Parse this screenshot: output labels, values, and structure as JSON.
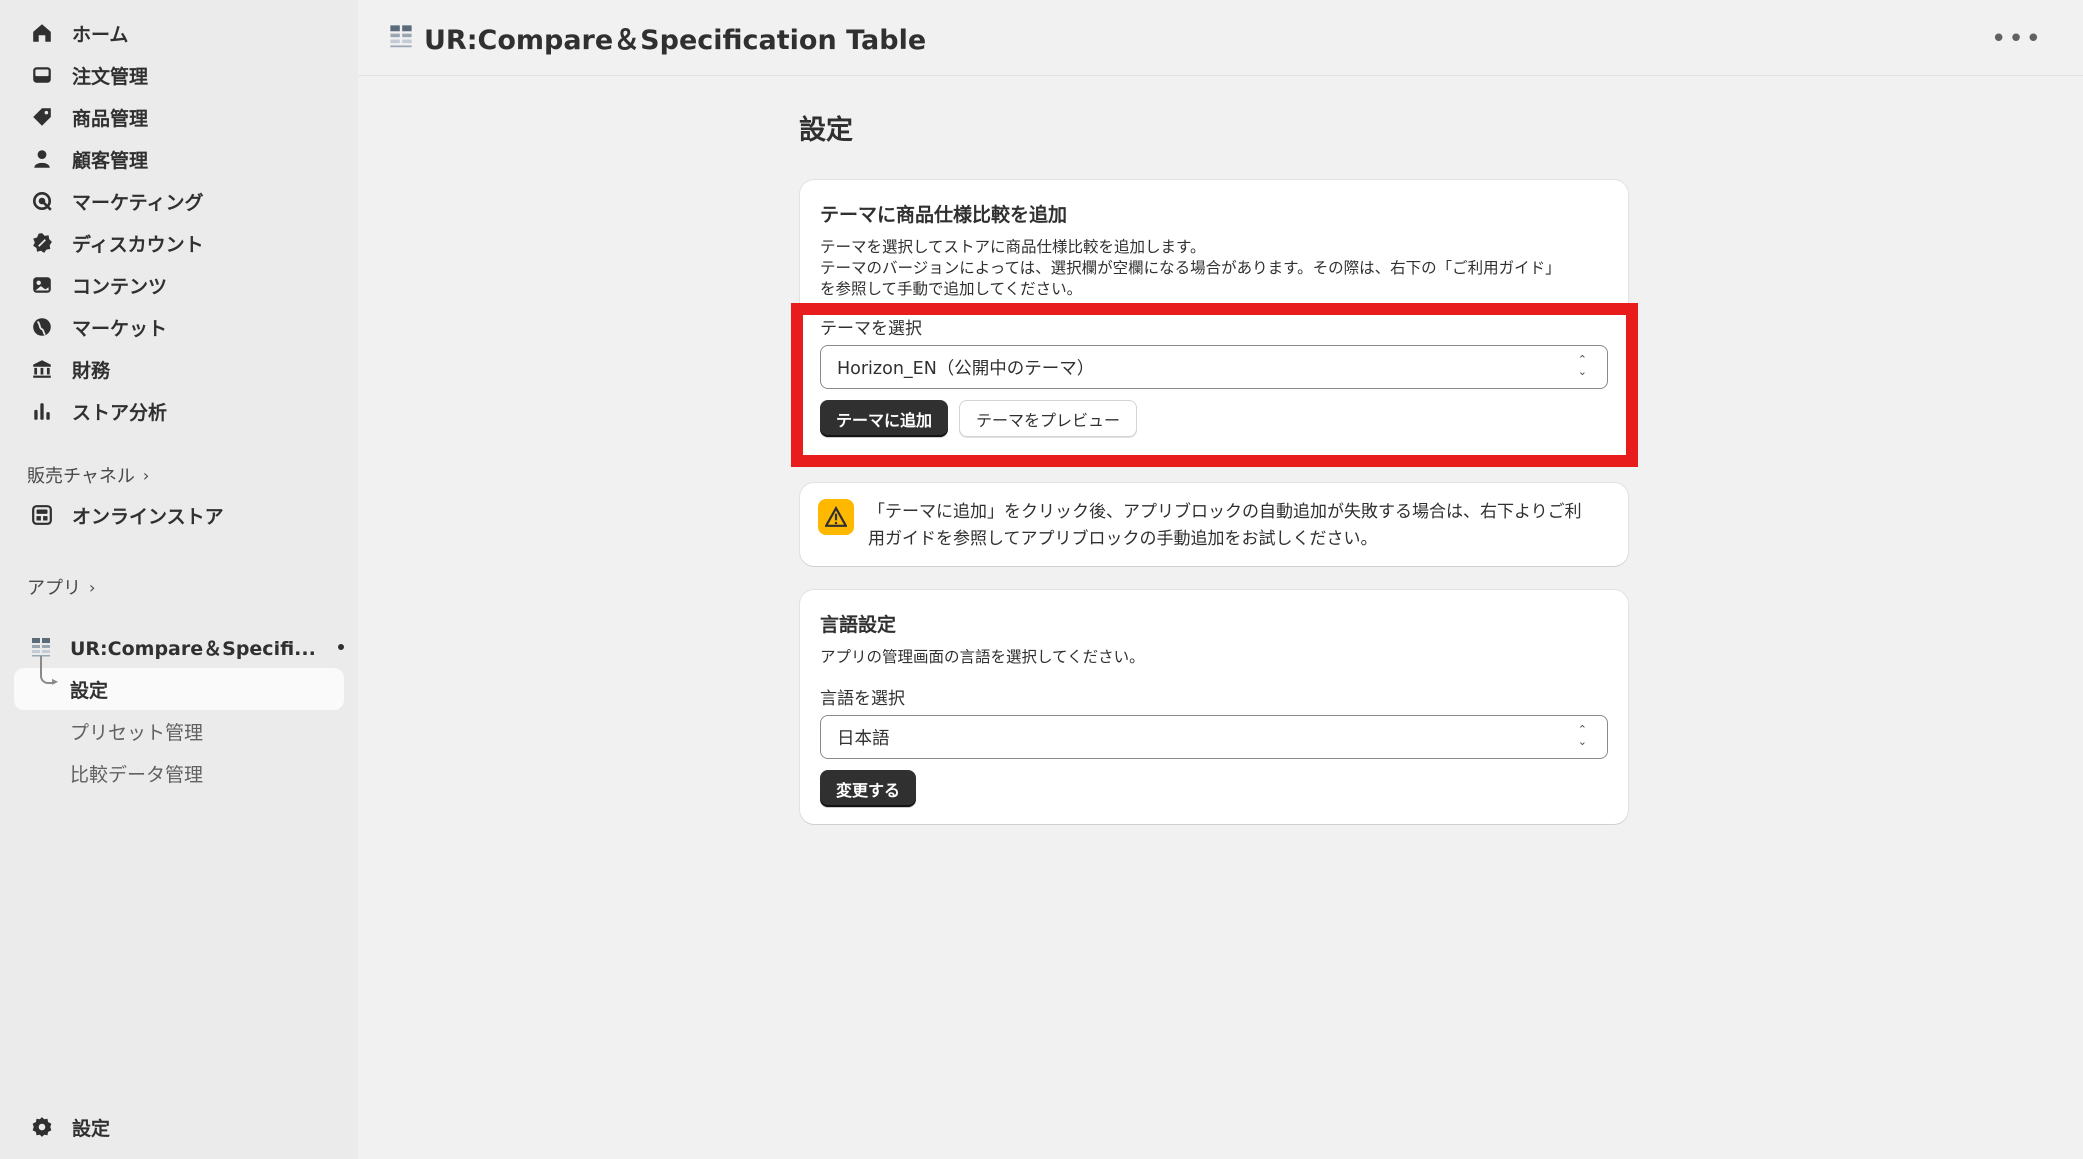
{
  "sidebar": {
    "items": [
      {
        "label": "ホーム",
        "icon": "home-icon"
      },
      {
        "label": "注文管理",
        "icon": "inbox-icon"
      },
      {
        "label": "商品管理",
        "icon": "tag-icon"
      },
      {
        "label": "顧客管理",
        "icon": "person-icon"
      },
      {
        "label": "マーケティング",
        "icon": "target-icon"
      },
      {
        "label": "ディスカウント",
        "icon": "discount-icon"
      },
      {
        "label": "コンテンツ",
        "icon": "image-icon"
      },
      {
        "label": "マーケット",
        "icon": "globe-icon"
      },
      {
        "label": "財務",
        "icon": "bank-icon"
      },
      {
        "label": "ストア分析",
        "icon": "bar-chart-icon"
      }
    ],
    "sales_channels_label": "販売チャネル",
    "online_store_label": "オンラインストア",
    "apps_label": "アプリ",
    "app_name": "UR:Compare＆Specifi...",
    "app_subitems": [
      "設定",
      "プリセット管理",
      "比較データ管理"
    ],
    "settings_label": "設定"
  },
  "header": {
    "title": "UR:Compare＆Specification Table",
    "more_label": "•••"
  },
  "main": {
    "page_title": "設定",
    "theme_card": {
      "title": "テーマに商品仕様比較を追加",
      "desc1": "テーマを選択してストアに商品仕様比較を追加します。",
      "desc2": "テーマのバージョンによっては、選択欄が空欄になる場合があります。その際は、右下の「ご利用ガイド」",
      "desc3": "を参照して手動で追加してください。",
      "select_label": "テーマを選択",
      "select_value": "Horizon_EN（公開中のテーマ）",
      "add_button": "テーマに追加",
      "preview_button": "テーマをプレビュー"
    },
    "warning": {
      "line1": "「テーマに追加」をクリック後、アプリブロックの自動追加が失敗する場合は、右下よりご利",
      "line2": "用ガイドを参照してアプリブロックの手動追加をお試しください。"
    },
    "language_card": {
      "title": "言語設定",
      "desc": "アプリの管理画面の言語を選択してください。",
      "select_label": "言語を選択",
      "select_value": "日本語",
      "change_button": "変更する"
    }
  },
  "colors": {
    "highlight": "#e81c1c",
    "warning": "#ffb800",
    "primary_button": "#303030"
  }
}
